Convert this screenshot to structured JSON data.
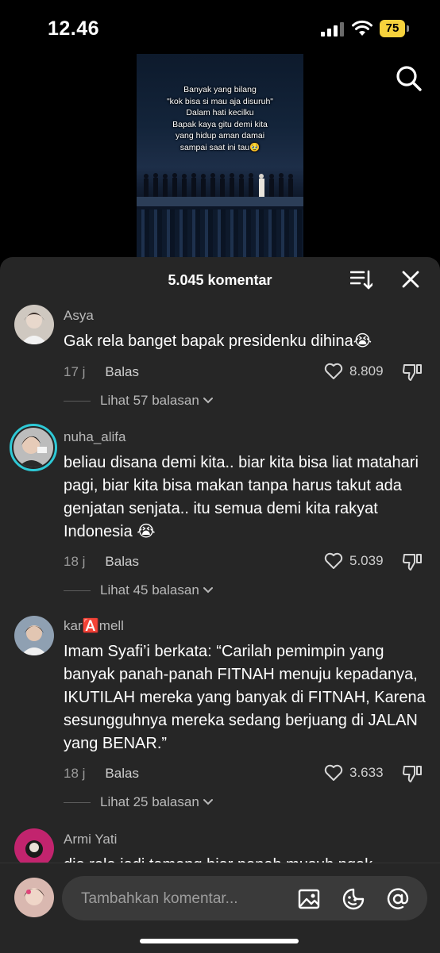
{
  "status_bar": {
    "time": "12.46",
    "battery": "75"
  },
  "video": {
    "caption_lines": [
      "Banyak yang bilang",
      "\"kok bisa si mau aja disuruh\"",
      "Dalam hati kecilku",
      "Bapak kaya gitu demi kita",
      "yang hidup aman damai",
      "sampai saat ini tau🥹"
    ]
  },
  "comments_sheet": {
    "count_label": "5.045 komentar",
    "reply_label": "Balas",
    "comments": [
      {
        "username": "Asya",
        "text": "Gak rela banget bapak presidenku dihina😭",
        "time": "17 j",
        "likes": "8.809",
        "view_replies": "Lihat 57 balasan"
      },
      {
        "username": "nuha_alifa",
        "text": "beliau disana demi kita.. biar kita bisa liat matahari pagi, biar kita bisa makan tanpa harus takut ada genjatan senjata.. itu semua demi kita rakyat Indonesia 😭",
        "time": "18 j",
        "likes": "5.039",
        "view_replies": "Lihat 45 balasan"
      },
      {
        "username": "kar🅰️mell",
        "text": "Imam Syafi’i berkata: “Carilah pemimpin yang banyak panah-panah FITNAH menuju kepadanya, IKUTILAH mereka yang banyak di FITNAH, Karena sesungguhnya mereka sedang berjuang di JALAN yang BENAR.”",
        "time": "18 j",
        "likes": "3.633",
        "view_replies": "Lihat 25 balasan"
      },
      {
        "username": "Armi Yati",
        "text": "dia rela jadi tameng biar panah musuh ngak"
      }
    ]
  },
  "composer": {
    "placeholder": "Tambahkan komentar..."
  },
  "colors": {
    "sheet_bg": "#262626",
    "story_ring": "#2ec9d6",
    "battery": "#f6d23c"
  }
}
